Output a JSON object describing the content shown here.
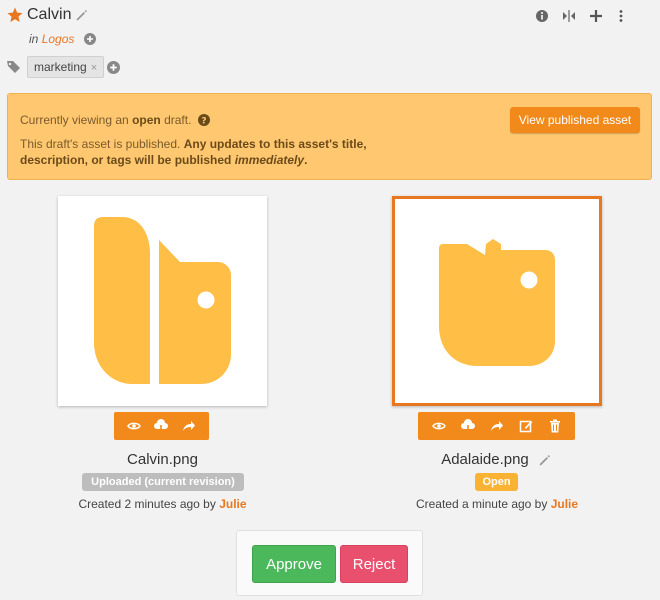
{
  "asset": {
    "title": "Calvin",
    "in_prefix": "in",
    "collection": "Logos"
  },
  "tags": [
    {
      "label": "marketing",
      "remove_glyph": "×"
    }
  ],
  "toolbar": {
    "icons": [
      "info-icon",
      "compare-icon",
      "add-icon",
      "more-icon"
    ]
  },
  "banner": {
    "line1_prefix": "Currently viewing an ",
    "line1_bold": "open",
    "line1_suffix": " draft.",
    "line2_prefix": "This draft's asset is published. ",
    "line2_bold": "Any updates to this asset's title, description, or tags will be published ",
    "line2_em": "immediately",
    "line2_end": ".",
    "button_label": "View published asset"
  },
  "revisions": [
    {
      "filename": "Calvin.png",
      "badge": "Uploaded (current revision)",
      "created_prefix": "Created 2 minutes ago by ",
      "user": "Julie",
      "actions": [
        "view-icon",
        "download-icon",
        "share-icon"
      ]
    },
    {
      "filename": "Adalaide.png",
      "badge": "Open",
      "created_prefix": "Created a minute ago by ",
      "user": "Julie",
      "actions": [
        "view-icon",
        "download-icon",
        "share-icon",
        "edit-icon",
        "delete-icon"
      ]
    }
  ],
  "decision": {
    "approve_label": "Approve",
    "reject_label": "Reject"
  },
  "colors": {
    "accent": "#f28a1b",
    "logo": "#ffbe45",
    "banner": "#ffc870",
    "approve": "#4cb85c",
    "reject": "#e8506e"
  }
}
